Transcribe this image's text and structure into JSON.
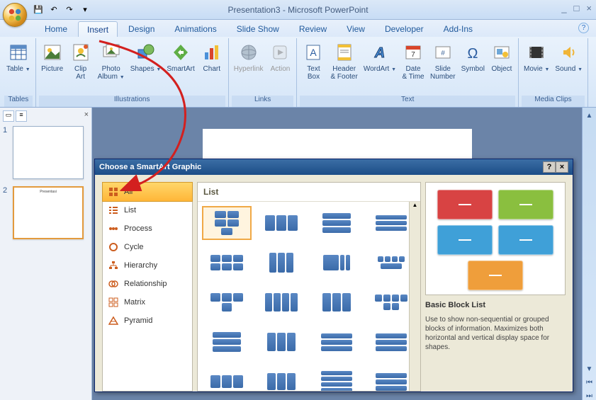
{
  "titlebar": {
    "title": "Presentation3 - Microsoft PowerPoint",
    "qat": {
      "save": "💾",
      "undo": "↶",
      "redo": "↷",
      "more": "▾"
    },
    "win": {
      "min": "_",
      "max": "□",
      "close": "×"
    }
  },
  "tabs": {
    "items": [
      "Home",
      "Insert",
      "Design",
      "Animations",
      "Slide Show",
      "Review",
      "View",
      "Developer",
      "Add-Ins"
    ],
    "active": "Insert"
  },
  "ribbon": {
    "groups": [
      {
        "label": "Tables",
        "buttons": [
          {
            "label": "Table",
            "drop": true
          }
        ]
      },
      {
        "label": "Illustrations",
        "buttons": [
          {
            "label": "Picture"
          },
          {
            "label": "Clip\nArt"
          },
          {
            "label": "Photo\nAlbum",
            "drop": true
          },
          {
            "label": "Shapes",
            "drop": true
          },
          {
            "label": "SmartArt"
          },
          {
            "label": "Chart"
          }
        ]
      },
      {
        "label": "Links",
        "buttons": [
          {
            "label": "Hyperlink",
            "gray": true
          },
          {
            "label": "Action",
            "gray": true
          }
        ]
      },
      {
        "label": "Text",
        "buttons": [
          {
            "label": "Text\nBox"
          },
          {
            "label": "Header\n& Footer"
          },
          {
            "label": "WordArt",
            "drop": true
          },
          {
            "label": "Date\n& Time"
          },
          {
            "label": "Slide\nNumber"
          },
          {
            "label": "Symbol"
          },
          {
            "label": "Object"
          }
        ]
      },
      {
        "label": "Media Clips",
        "buttons": [
          {
            "label": "Movie",
            "drop": true
          },
          {
            "label": "Sound",
            "drop": true
          }
        ]
      }
    ]
  },
  "slides": {
    "items": [
      {
        "n": "1"
      },
      {
        "n": "2",
        "text": "Presentasi"
      }
    ]
  },
  "dialog": {
    "title": "Choose a SmartArt Graphic",
    "help": "?",
    "close": "×",
    "categories": [
      "All",
      "List",
      "Process",
      "Cycle",
      "Hierarchy",
      "Relationship",
      "Matrix",
      "Pyramid"
    ],
    "selected_cat": "All",
    "gallery_header": "List",
    "preview_colors": [
      "#d84343",
      "#8abf3f",
      "#3fa0d8",
      "#3fa0d8",
      "#ef9e3b"
    ],
    "preview_title": "Basic Block List",
    "preview_desc": "Use to show non-sequential or grouped blocks of information. Maximizes both horizontal and vertical display space for shapes."
  }
}
